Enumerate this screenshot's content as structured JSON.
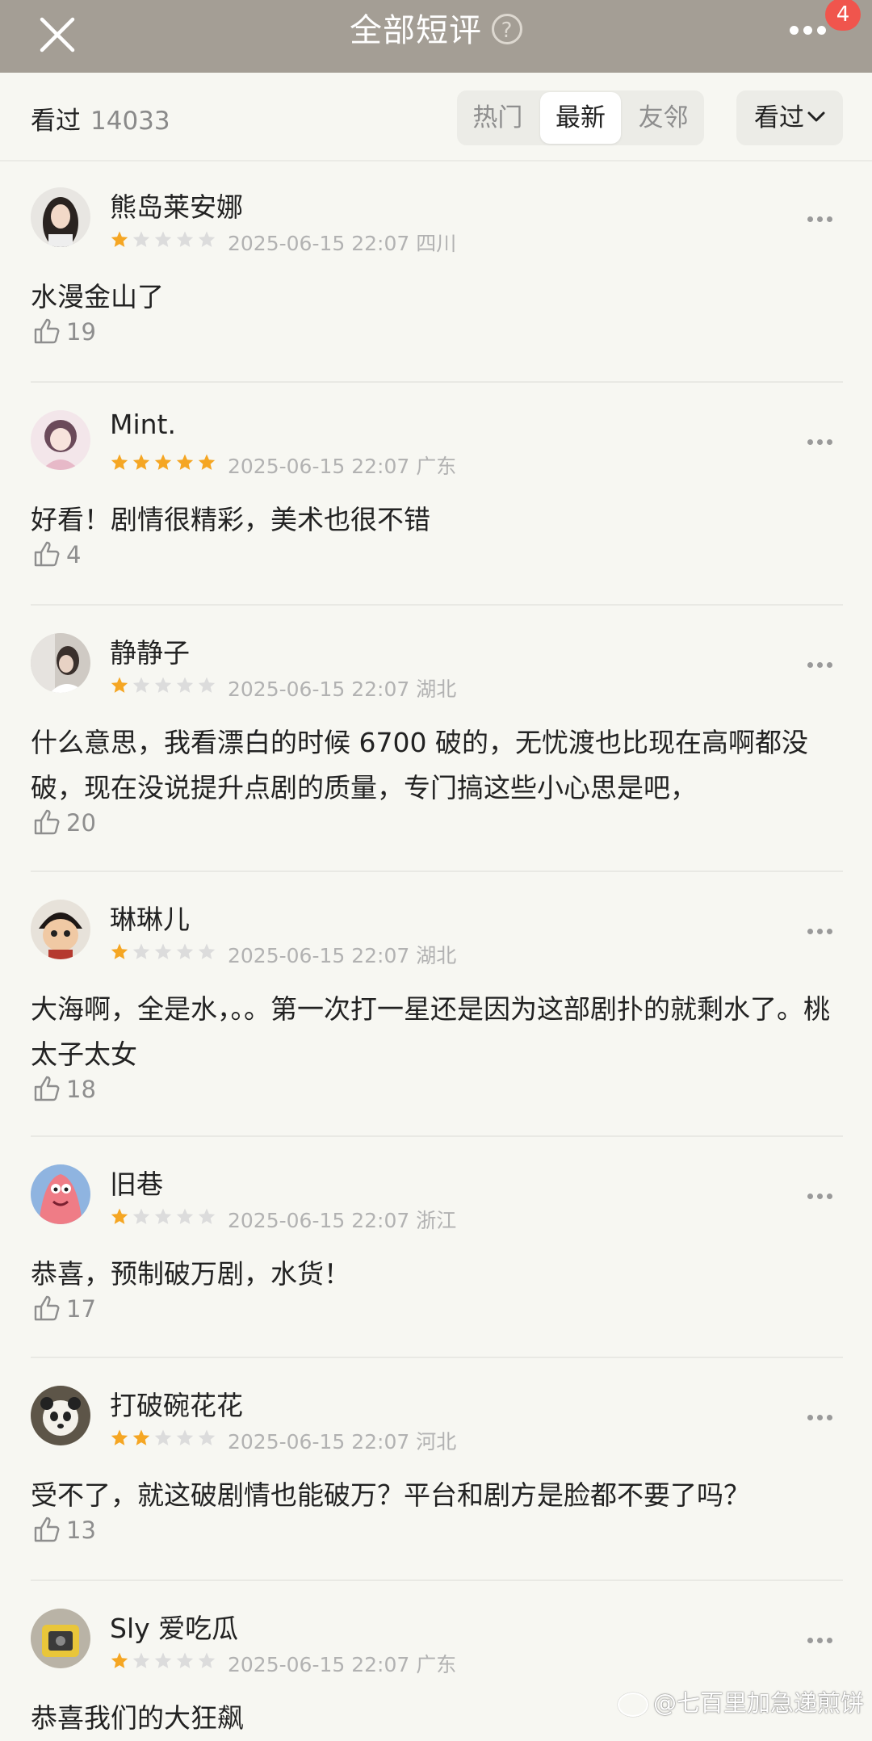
{
  "header": {
    "title": "全部短评",
    "help_glyph": "?",
    "badge_count": "4"
  },
  "filter": {
    "seen_label": "看过",
    "seen_count": "14033",
    "tabs": [
      "热门",
      "最新",
      "友邻"
    ],
    "active_tab": "最新",
    "dropdown_label": "看过"
  },
  "comments": [
    {
      "name": "熊岛莱安娜",
      "rating": 1,
      "time": "2025-06-15 22:07",
      "region": "四川",
      "text": "水漫金山了",
      "likes": "19"
    },
    {
      "name": "Mint.",
      "rating": 5,
      "time": "2025-06-15 22:07",
      "region": "广东",
      "text": "好看！剧情很精彩，美术也很不错",
      "likes": "4"
    },
    {
      "name": "静静子",
      "rating": 1,
      "time": "2025-06-15 22:07",
      "region": "湖北",
      "text": "什么意思，我看漂白的时候 6700 破的，无忧渡也比现在高啊都没破，现在没说提升点剧的质量，专门搞这些小心思是吧，",
      "likes": "20"
    },
    {
      "name": "琳琳儿",
      "rating": 1,
      "time": "2025-06-15 22:07",
      "region": "湖北",
      "text": "大海啊，全是水，。。第一次打一星还是因为这部剧扑的就剩水了。桃太子太女",
      "likes": "18"
    },
    {
      "name": "旧巷",
      "rating": 1,
      "time": "2025-06-15 22:07",
      "region": "浙江",
      "text": "恭喜，预制破万剧，水货！",
      "likes": "17"
    },
    {
      "name": "打破碗花花",
      "rating": 2,
      "time": "2025-06-15 22:07",
      "region": "河北",
      "text": "受不了，就这破剧情也能破万？平台和剧方是脸都不要了吗？",
      "likes": "13"
    },
    {
      "name": "Sly 爱吃瓜",
      "rating": 1,
      "time": "2025-06-15 22:07",
      "region": "广东",
      "text": "恭喜我们的大狂飙",
      "likes": ""
    }
  ],
  "watermark": "@七百里加急递煎饼",
  "colors": {
    "header_bg": "#a49e95",
    "star_filled": "#f5a623",
    "star_empty": "#dcdcdc",
    "badge": "#f0554d"
  },
  "icons": [
    "close-icon",
    "help-icon",
    "more-icon",
    "chevron-down-icon",
    "star-icon",
    "thumbs-up-icon",
    "weibo-icon"
  ]
}
